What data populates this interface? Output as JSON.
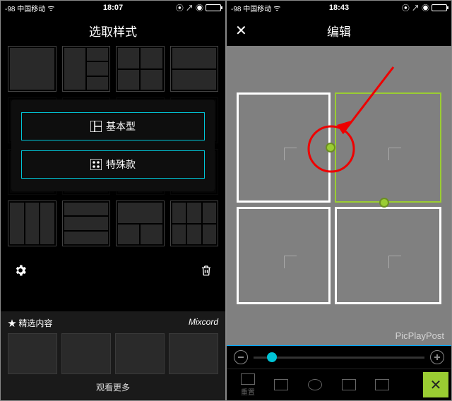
{
  "left": {
    "status": {
      "carrier": "-98 中国移动",
      "wifi": "✓",
      "time": "18:07",
      "indicators": "◉ ◭ ⦿"
    },
    "title": "选取样式",
    "options": {
      "basic": "基本型",
      "special": "特殊款"
    },
    "featured": {
      "header": "精选内容",
      "brand": "Mixcord",
      "more": "观看更多"
    },
    "icons": {
      "star": "★",
      "gear": "⚙",
      "trash": "🗑"
    }
  },
  "right": {
    "status": {
      "carrier": "-98 中国移动",
      "wifi": "✓",
      "time": "18:43",
      "indicators": "◉ ◭ ⦿"
    },
    "title": "编辑",
    "close": "✕",
    "watermark": "PicPlayPost",
    "tools": {
      "reset": "重置"
    },
    "closebtn": "✕"
  }
}
